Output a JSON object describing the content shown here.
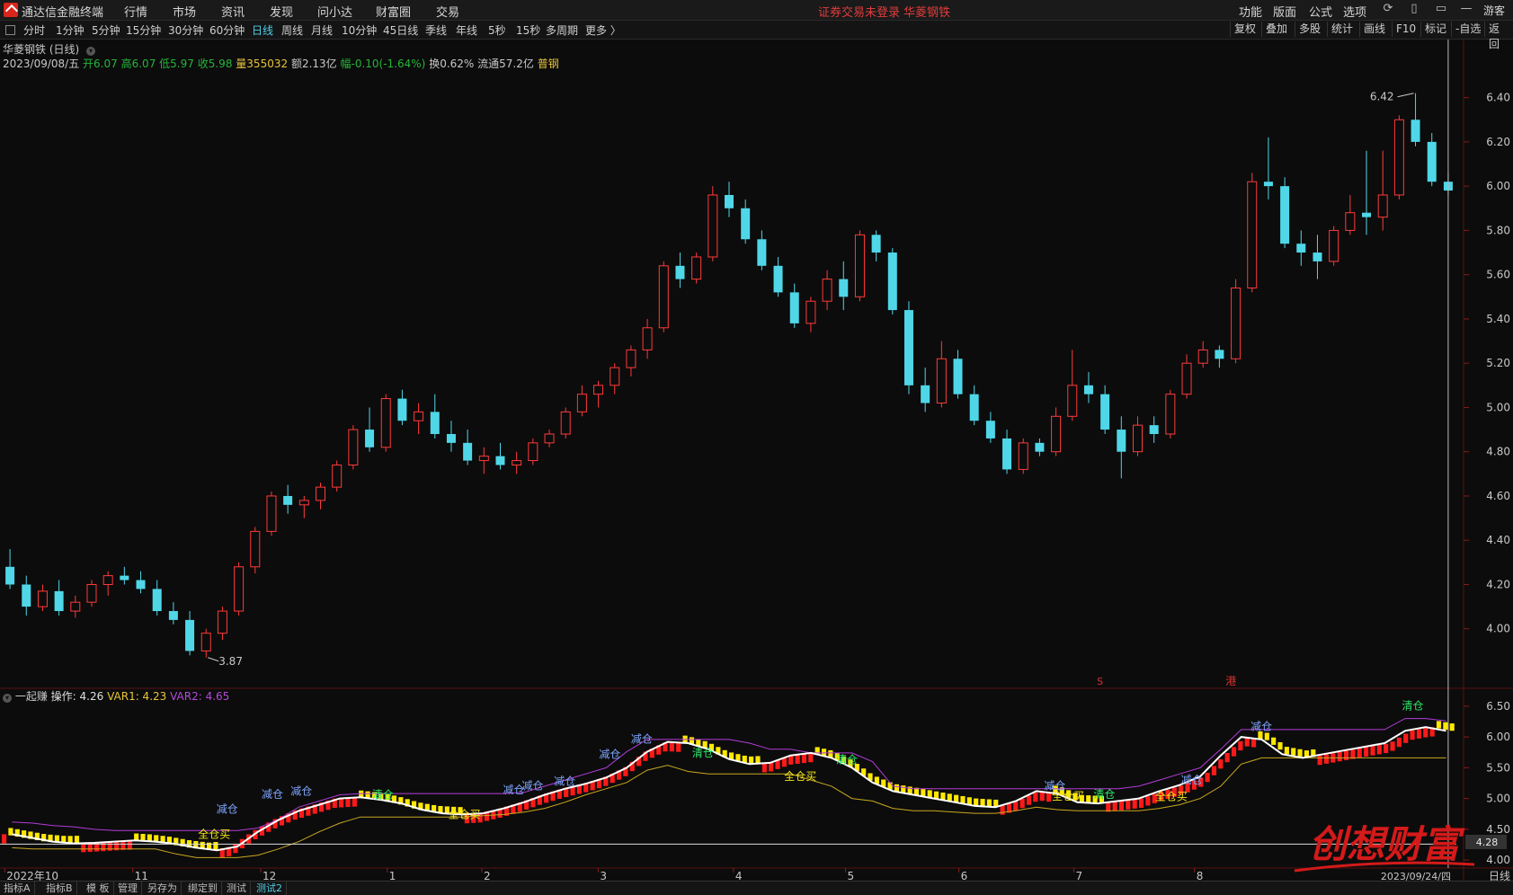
{
  "menubar": {
    "app_title": "通达信金融终端",
    "menus": [
      "行情",
      "市场",
      "资讯",
      "发现",
      "问小达",
      "财富圈",
      "交易"
    ],
    "status_text": "证券交易未登录",
    "stock_name": "华菱钢铁",
    "right_menus": [
      "功能",
      "版面",
      "公式",
      "选项"
    ],
    "user": "游客"
  },
  "toolbar": {
    "periods": [
      "分时",
      "1分钟",
      "5分钟",
      "15分钟",
      "30分钟",
      "60分钟",
      "日线",
      "周线",
      "月线",
      "10分钟",
      "45日线",
      "季线",
      "年线",
      "5秒",
      "15秒",
      "多周期",
      "更多 〉"
    ],
    "active_period": "日线",
    "right_buttons": [
      "复权",
      "叠加",
      "多股",
      "统计",
      "画线",
      "F10",
      "标记",
      "-自选",
      "返回"
    ]
  },
  "info": {
    "title": "华菱钢铁 (日线)",
    "date": "2023/09/08/五",
    "open": "开6.07",
    "high": "高6.07",
    "low": "低5.97",
    "close": "收5.98",
    "volume": "量355032",
    "amount": "额2.13亿",
    "change": "幅-0.10(-1.64%)",
    "turnover": "换0.62%",
    "float": "流通57.2亿",
    "sector": "普钢"
  },
  "main_chart": {
    "price_axis": [
      "6.40",
      "6.20",
      "6.00",
      "5.80",
      "5.60",
      "5.40",
      "5.20",
      "5.00",
      "4.80",
      "4.60",
      "4.40",
      "4.20",
      "4.00"
    ],
    "high_marker": "6.42",
    "low_marker": "3.87",
    "markers": [
      "S",
      "港"
    ]
  },
  "indicator": {
    "name": "一起赚",
    "op_label": "操作: 4.26",
    "var1_label": "VAR1: 4.23",
    "var2_label": "VAR2: 4.65",
    "axis": [
      "6.50",
      "6.00",
      "5.50",
      "5.00",
      "4.50",
      "4.00"
    ],
    "current_value": "4.28",
    "signals": [
      {
        "text": "全仓买",
        "x": 0.146,
        "y": 4.36
      },
      {
        "text": "减仓",
        "x": 0.155,
        "y": 4.77
      },
      {
        "text": "减仓",
        "x": 0.186,
        "y": 5.01
      },
      {
        "text": "减仓",
        "x": 0.206,
        "y": 5.06
      },
      {
        "text": "清仓",
        "x": 0.262,
        "y": 5.0
      },
      {
        "text": "全仓买",
        "x": 0.318,
        "y": 4.68
      },
      {
        "text": "减仓",
        "x": 0.352,
        "y": 5.08
      },
      {
        "text": "减仓",
        "x": 0.365,
        "y": 5.15
      },
      {
        "text": "减仓",
        "x": 0.387,
        "y": 5.22
      },
      {
        "text": "减仓",
        "x": 0.418,
        "y": 5.66
      },
      {
        "text": "减仓",
        "x": 0.44,
        "y": 5.91
      },
      {
        "text": "清仓",
        "x": 0.482,
        "y": 5.68
      },
      {
        "text": "全仓买",
        "x": 0.549,
        "y": 5.3
      },
      {
        "text": "清仓",
        "x": 0.581,
        "y": 5.57
      },
      {
        "text": "减仓",
        "x": 0.724,
        "y": 5.15
      },
      {
        "text": "全仓买",
        "x": 0.733,
        "y": 4.98
      },
      {
        "text": "清仓",
        "x": 0.758,
        "y": 5.01
      },
      {
        "text": "全仓买",
        "x": 0.804,
        "y": 4.97
      },
      {
        "text": "减仓",
        "x": 0.818,
        "y": 5.24
      },
      {
        "text": "减仓",
        "x": 0.866,
        "y": 6.11
      },
      {
        "text": "清仓",
        "x": 0.97,
        "y": 6.45
      }
    ]
  },
  "date_axis": [
    "2022年10",
    "11",
    "12",
    "1",
    "2",
    "3",
    "4",
    "5",
    "6",
    "7",
    "8"
  ],
  "date_axis_right": "2023/09/24/四",
  "period_label": "日线",
  "bottom_tabs": [
    "指标A",
    "指标B",
    "模 板",
    "管理",
    "另存为",
    "绑定到",
    "测试",
    "测试2"
  ],
  "active_bottom_tab": "测试2",
  "watermark": {
    "text": "创想财富"
  },
  "chart_data": [
    {
      "type": "candlestick",
      "title": "华菱钢铁 (日线)",
      "ylim": [
        3.8,
        6.5
      ],
      "x_range": [
        "2022/10",
        "2023/09/08"
      ],
      "candles": [
        [
          4.28,
          4.36,
          4.18,
          4.2
        ],
        [
          4.2,
          4.24,
          4.06,
          4.1
        ],
        [
          4.1,
          4.2,
          4.08,
          4.17
        ],
        [
          4.17,
          4.22,
          4.06,
          4.08
        ],
        [
          4.08,
          4.15,
          4.05,
          4.12
        ],
        [
          4.12,
          4.22,
          4.1,
          4.2
        ],
        [
          4.2,
          4.26,
          4.15,
          4.24
        ],
        [
          4.24,
          4.28,
          4.2,
          4.22
        ],
        [
          4.22,
          4.26,
          4.16,
          4.18
        ],
        [
          4.18,
          4.22,
          4.06,
          4.08
        ],
        [
          4.08,
          4.12,
          4.02,
          4.04
        ],
        [
          4.04,
          4.08,
          3.88,
          3.9
        ],
        [
          3.9,
          4.0,
          3.87,
          3.98
        ],
        [
          3.98,
          4.1,
          3.95,
          4.08
        ],
        [
          4.08,
          4.3,
          4.06,
          4.28
        ],
        [
          4.28,
          4.46,
          4.25,
          4.44
        ],
        [
          4.44,
          4.62,
          4.42,
          4.6
        ],
        [
          4.6,
          4.65,
          4.52,
          4.56
        ],
        [
          4.56,
          4.6,
          4.5,
          4.58
        ],
        [
          4.58,
          4.66,
          4.54,
          4.64
        ],
        [
          4.64,
          4.76,
          4.62,
          4.74
        ],
        [
          4.74,
          4.92,
          4.72,
          4.9
        ],
        [
          4.9,
          5.0,
          4.8,
          4.82
        ],
        [
          4.82,
          5.06,
          4.8,
          5.04
        ],
        [
          5.04,
          5.08,
          4.92,
          4.94
        ],
        [
          4.94,
          5.02,
          4.88,
          4.98
        ],
        [
          4.98,
          5.06,
          4.86,
          4.88
        ],
        [
          4.88,
          4.94,
          4.8,
          4.84
        ],
        [
          4.84,
          4.9,
          4.74,
          4.76
        ],
        [
          4.76,
          4.82,
          4.7,
          4.78
        ],
        [
          4.78,
          4.84,
          4.72,
          4.74
        ],
        [
          4.74,
          4.8,
          4.7,
          4.76
        ],
        [
          4.76,
          4.86,
          4.74,
          4.84
        ],
        [
          4.84,
          4.9,
          4.82,
          4.88
        ],
        [
          4.88,
          5.0,
          4.86,
          4.98
        ],
        [
          4.98,
          5.1,
          4.96,
          5.06
        ],
        [
          5.06,
          5.12,
          5.0,
          5.1
        ],
        [
          5.1,
          5.2,
          5.06,
          5.18
        ],
        [
          5.18,
          5.28,
          5.14,
          5.26
        ],
        [
          5.26,
          5.4,
          5.22,
          5.36
        ],
        [
          5.36,
          5.66,
          5.34,
          5.64
        ],
        [
          5.64,
          5.7,
          5.54,
          5.58
        ],
        [
          5.58,
          5.7,
          5.56,
          5.68
        ],
        [
          5.68,
          6.0,
          5.66,
          5.96
        ],
        [
          5.96,
          6.02,
          5.86,
          5.9
        ],
        [
          5.9,
          5.94,
          5.74,
          5.76
        ],
        [
          5.76,
          5.8,
          5.62,
          5.64
        ],
        [
          5.64,
          5.68,
          5.5,
          5.52
        ],
        [
          5.52,
          5.56,
          5.36,
          5.38
        ],
        [
          5.38,
          5.5,
          5.34,
          5.48
        ],
        [
          5.48,
          5.62,
          5.44,
          5.58
        ],
        [
          5.58,
          5.66,
          5.44,
          5.5
        ],
        [
          5.5,
          5.8,
          5.48,
          5.78
        ],
        [
          5.78,
          5.8,
          5.66,
          5.7
        ],
        [
          5.7,
          5.72,
          5.42,
          5.44
        ],
        [
          5.44,
          5.48,
          5.06,
          5.1
        ],
        [
          5.1,
          5.18,
          4.98,
          5.02
        ],
        [
          5.02,
          5.3,
          5.0,
          5.22
        ],
        [
          5.22,
          5.26,
          5.04,
          5.06
        ],
        [
          5.06,
          5.1,
          4.92,
          4.94
        ],
        [
          4.94,
          4.98,
          4.84,
          4.86
        ],
        [
          4.86,
          4.9,
          4.7,
          4.72
        ],
        [
          4.72,
          4.86,
          4.7,
          4.84
        ],
        [
          4.84,
          4.86,
          4.78,
          4.8
        ],
        [
          4.8,
          5.0,
          4.78,
          4.96
        ],
        [
          4.96,
          5.26,
          4.94,
          5.1
        ],
        [
          5.1,
          5.16,
          5.02,
          5.06
        ],
        [
          5.06,
          5.1,
          4.88,
          4.9
        ],
        [
          4.9,
          4.96,
          4.68,
          4.8
        ],
        [
          4.8,
          4.96,
          4.78,
          4.92
        ],
        [
          4.92,
          4.96,
          4.84,
          4.88
        ],
        [
          4.88,
          5.08,
          4.86,
          5.06
        ],
        [
          5.06,
          5.24,
          5.04,
          5.2
        ],
        [
          5.2,
          5.3,
          5.18,
          5.26
        ],
        [
          5.26,
          5.28,
          5.18,
          5.22
        ],
        [
          5.22,
          5.58,
          5.2,
          5.54
        ],
        [
          5.54,
          6.06,
          5.52,
          6.02
        ],
        [
          6.02,
          6.22,
          5.94,
          6.0
        ],
        [
          6.0,
          6.04,
          5.72,
          5.74
        ],
        [
          5.74,
          5.8,
          5.64,
          5.7
        ],
        [
          5.7,
          5.78,
          5.58,
          5.66
        ],
        [
          5.66,
          5.82,
          5.64,
          5.8
        ],
        [
          5.8,
          5.96,
          5.78,
          5.88
        ],
        [
          5.88,
          6.16,
          5.78,
          5.86
        ],
        [
          5.86,
          6.16,
          5.8,
          5.96
        ],
        [
          5.96,
          6.32,
          5.94,
          6.3
        ],
        [
          6.3,
          6.42,
          6.18,
          6.2
        ],
        [
          6.2,
          6.24,
          6.0,
          6.02
        ],
        [
          6.02,
          6.06,
          5.96,
          5.98
        ]
      ]
    },
    {
      "type": "line",
      "title": "一起赚",
      "ylim": [
        3.9,
        6.6
      ],
      "series": [
        {
          "name": "操作",
          "values": [
            4.42,
            4.36,
            4.3,
            4.27,
            4.28,
            4.3,
            4.32,
            4.3,
            4.26,
            4.2,
            4.16,
            4.22,
            4.46,
            4.65,
            4.8,
            4.9,
            5.0,
            5.02,
            4.98,
            4.92,
            4.82,
            4.76,
            4.74,
            4.76,
            4.84,
            4.94,
            5.06,
            5.16,
            5.24,
            5.34,
            5.5,
            5.76,
            5.92,
            5.9,
            5.8,
            5.64,
            5.56,
            5.58,
            5.7,
            5.74,
            5.66,
            5.5,
            5.26,
            5.12,
            5.06,
            5.0,
            4.94,
            4.88,
            4.86,
            4.96,
            5.12,
            5.08,
            4.94,
            4.92,
            4.96,
            5.0,
            5.12,
            5.22,
            5.36,
            5.7,
            6.0,
            5.96,
            5.72,
            5.66,
            5.72,
            5.78,
            5.84,
            5.9,
            6.1,
            6.16,
            6.1
          ]
        },
        {
          "name": "VAR1",
          "values": [
            4.2,
            4.18,
            4.18,
            4.18,
            4.18,
            4.18,
            4.18,
            4.18,
            4.1,
            4.04,
            4.04,
            4.04,
            4.08,
            4.18,
            4.3,
            4.46,
            4.6,
            4.7,
            4.7,
            4.7,
            4.7,
            4.7,
            4.7,
            4.72,
            4.74,
            4.78,
            4.84,
            4.94,
            5.06,
            5.16,
            5.26,
            5.46,
            5.54,
            5.44,
            5.4,
            5.4,
            5.4,
            5.4,
            5.4,
            5.3,
            5.2,
            5.0,
            4.96,
            4.84,
            4.8,
            4.8,
            4.78,
            4.76,
            4.76,
            4.8,
            4.86,
            4.82,
            4.8,
            4.8,
            4.8,
            4.8,
            4.84,
            4.9,
            5.0,
            5.2,
            5.56,
            5.66,
            5.66,
            5.66,
            5.66,
            5.66,
            5.66,
            5.66,
            5.66,
            5.66,
            5.66
          ]
        },
        {
          "name": "VAR2",
          "values": [
            4.62,
            4.6,
            4.56,
            4.54,
            4.5,
            4.48,
            4.48,
            4.48,
            4.48,
            4.48,
            4.48,
            4.48,
            4.52,
            4.66,
            4.86,
            4.96,
            5.06,
            5.08,
            5.08,
            5.08,
            5.08,
            5.08,
            5.08,
            5.08,
            5.08,
            5.1,
            5.2,
            5.3,
            5.4,
            5.5,
            5.76,
            5.96,
            5.96,
            5.96,
            5.96,
            5.96,
            5.9,
            5.8,
            5.8,
            5.74,
            5.74,
            5.74,
            5.6,
            5.2,
            5.16,
            5.16,
            5.16,
            5.16,
            5.16,
            5.16,
            5.16,
            5.16,
            5.16,
            5.16,
            5.16,
            5.2,
            5.3,
            5.4,
            5.5,
            5.8,
            6.12,
            6.12,
            6.12,
            6.12,
            6.12,
            6.12,
            6.12,
            6.12,
            6.3,
            6.3,
            6.26
          ]
        }
      ]
    }
  ]
}
